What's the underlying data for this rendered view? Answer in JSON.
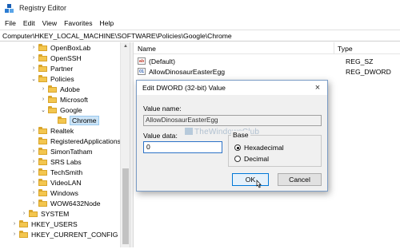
{
  "window": {
    "title": "Registry Editor",
    "icon": "registry-icon"
  },
  "menu": [
    "File",
    "Edit",
    "View",
    "Favorites",
    "Help"
  ],
  "address": "Computer\\HKEY_LOCAL_MACHINE\\SOFTWARE\\Policies\\Google\\Chrome",
  "tree": [
    {
      "label": "OpenBoxLab",
      "chevron": "›"
    },
    {
      "label": "OpenSSH",
      "chevron": "›"
    },
    {
      "label": "Partner",
      "chevron": "›"
    },
    {
      "label": "Policies",
      "chevron": "⌄"
    },
    {
      "label": "Adobe",
      "chevron": "›"
    },
    {
      "label": "Microsoft",
      "chevron": "›"
    },
    {
      "label": "Google",
      "chevron": "⌄"
    },
    {
      "label": "Chrome",
      "chevron": ""
    },
    {
      "label": "Realtek",
      "chevron": "›"
    },
    {
      "label": "RegisteredApplications",
      "chevron": ""
    },
    {
      "label": "SimonTatham",
      "chevron": "›"
    },
    {
      "label": "SRS Labs",
      "chevron": "›"
    },
    {
      "label": "TechSmith",
      "chevron": "›"
    },
    {
      "label": "VideoLAN",
      "chevron": "›"
    },
    {
      "label": "Windows",
      "chevron": "›"
    },
    {
      "label": "WOW6432Node",
      "chevron": "›"
    },
    {
      "label": "SYSTEM",
      "chevron": "›"
    },
    {
      "label": "HKEY_USERS",
      "chevron": "›"
    },
    {
      "label": "HKEY_CURRENT_CONFIG",
      "chevron": "›"
    }
  ],
  "list": {
    "headers": {
      "name": "Name",
      "type": "Type"
    },
    "rows": [
      {
        "icon": "ab",
        "name": "(Default)",
        "type": "REG_SZ"
      },
      {
        "icon": "01",
        "name": "AllowDinosaurEasterEgg",
        "type": "REG_DWORD"
      }
    ]
  },
  "dialog": {
    "title": "Edit DWORD (32-bit) Value",
    "close": "×",
    "value_name_label": "Value name:",
    "value_name": "AllowDinosaurEasterEgg",
    "watermark": "TheWindowsClub",
    "value_data_label": "Value data:",
    "value_data": "0",
    "base_label": "Base",
    "radio_hex": "Hexadecimal",
    "radio_dec": "Decimal",
    "ok": "OK",
    "cancel": "Cancel"
  }
}
